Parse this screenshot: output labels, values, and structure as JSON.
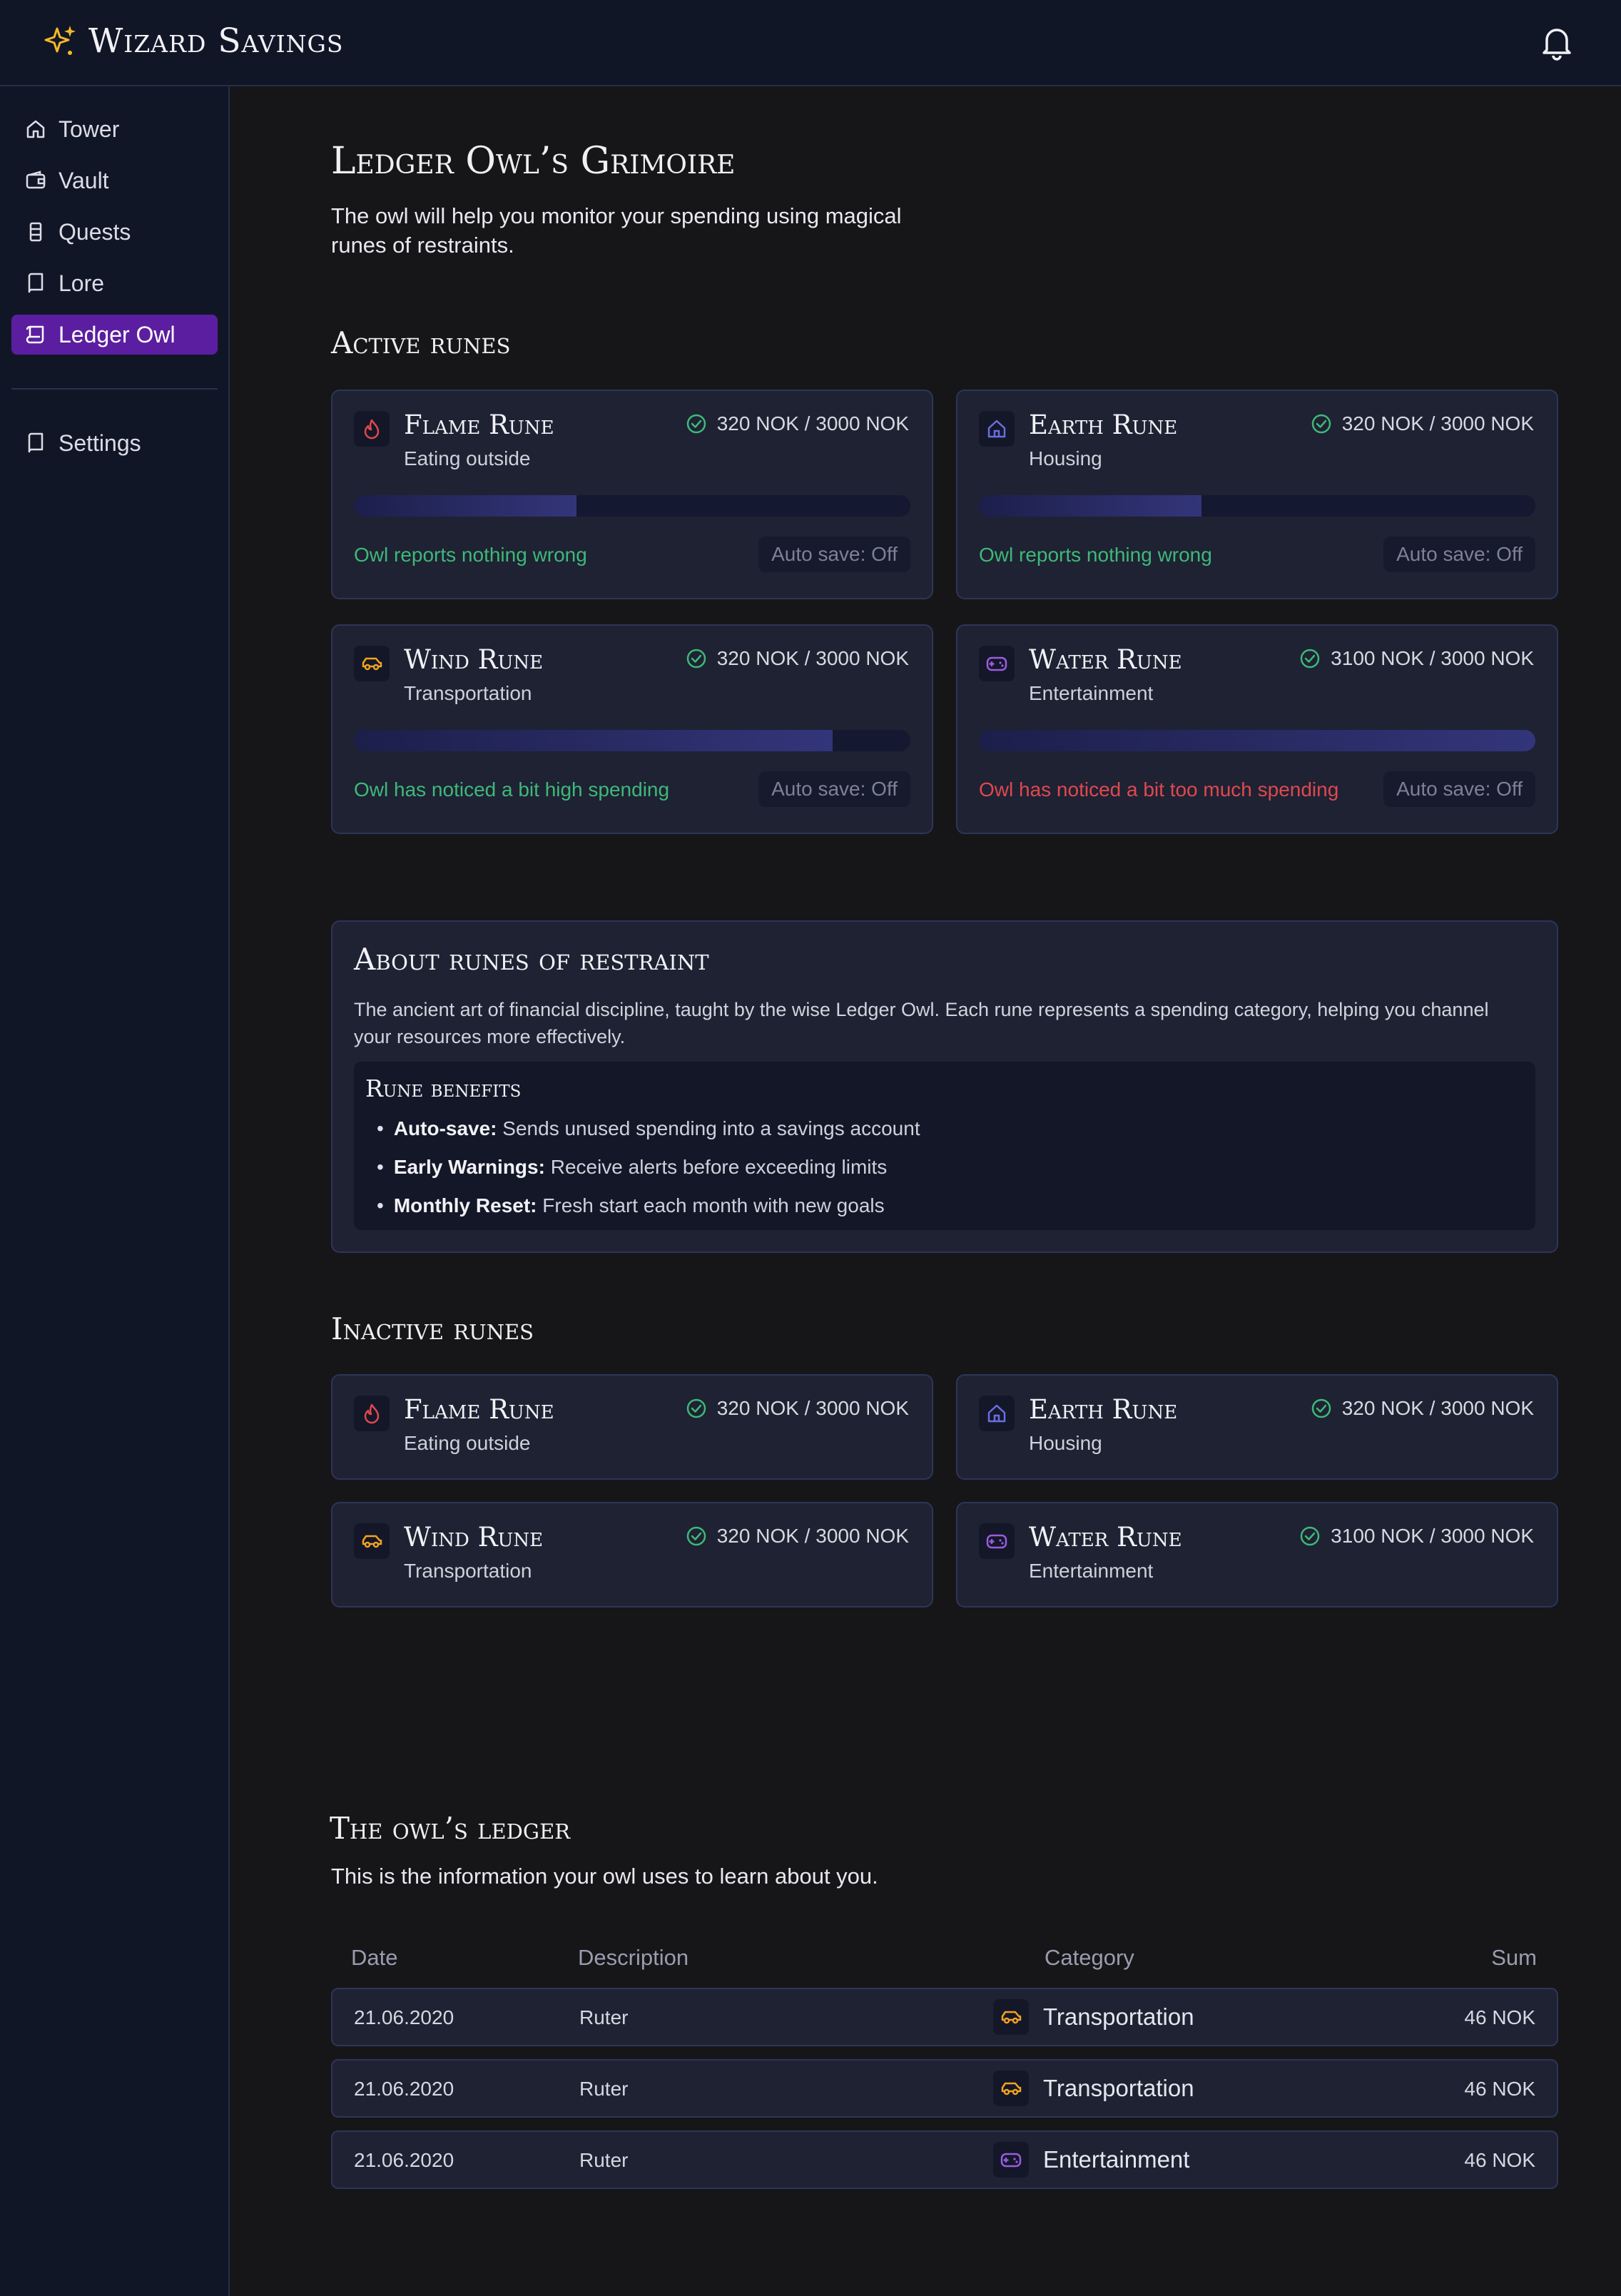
{
  "app": {
    "title": "Wizard Savings",
    "brand_color": "#f4b82a",
    "accent": "#5c1ea0"
  },
  "sidebar": {
    "items": [
      {
        "label": "Tower",
        "icon": "home-icon"
      },
      {
        "label": "Vault",
        "icon": "wallet-icon"
      },
      {
        "label": "Quests",
        "icon": "quest-icon"
      },
      {
        "label": "Lore",
        "icon": "book-icon"
      },
      {
        "label": "Ledger Owl",
        "icon": "scroll-icon",
        "active": true
      }
    ],
    "settings": {
      "label": "Settings",
      "icon": "book-icon"
    }
  },
  "page": {
    "title": "Ledger Owl’s Grimoire",
    "description": "The owl will help you monitor your spending using magical runes of restraints."
  },
  "active_runes": {
    "title": "Active runes",
    "cards": [
      {
        "name": "Flame Rune",
        "category": "Eating outside",
        "amount": "320 NOK / 3000 NOK",
        "progress": 0.4,
        "status": "Owl reports nothing wrong",
        "status_type": "ok",
        "autosave": "Auto save: Off",
        "icon": "flame-icon",
        "icon_color": "#e0484e"
      },
      {
        "name": "Earth Rune",
        "category": "Housing",
        "amount": "320 NOK / 3000 NOK",
        "progress": 0.4,
        "status": "Owl reports nothing wrong",
        "status_type": "ok",
        "autosave": "Auto save: Off",
        "icon": "house-icon",
        "icon_color": "#6a6ee0"
      },
      {
        "name": "Wind Rune",
        "category": "Transportation",
        "amount": "320 NOK / 3000 NOK",
        "progress": 0.86,
        "status": "Owl has noticed a bit high spending",
        "status_type": "ok",
        "autosave": "Auto save: Off",
        "icon": "car-icon",
        "icon_color": "#f4a31f"
      },
      {
        "name": "Water Rune",
        "category": "Entertainment",
        "amount": "3100 NOK / 3000 NOK",
        "progress": 1.0,
        "status": "Owl has noticed a bit too much spending",
        "status_type": "bad",
        "autosave": "Auto save: Off",
        "icon": "gamepad-icon",
        "icon_color": "#9a5ce0"
      }
    ]
  },
  "about": {
    "title": "About runes of restraint",
    "text": "The ancient art of financial discipline, taught by the wise Ledger Owl.  Each rune represents a spending category, helping you channel your  resources more effectively.",
    "benefits_title": "Rune benefits",
    "benefits": [
      {
        "term": "Auto-save:",
        "text": " Sends unused spending into a savings account"
      },
      {
        "term": "Early Warnings:",
        "text": " Receive alerts before exceeding limits"
      },
      {
        "term": "Monthly Reset:",
        "text": " Fresh start each month with new goals"
      }
    ]
  },
  "inactive_runes": {
    "title": "Inactive runes",
    "cards": [
      {
        "name": "Flame Rune",
        "category": "Eating outside",
        "amount": "320 NOK / 3000 NOK",
        "icon": "flame-icon"
      },
      {
        "name": "Earth Rune",
        "category": "Housing",
        "amount": "320 NOK / 3000 NOK",
        "icon": "house-icon"
      },
      {
        "name": "Wind Rune",
        "category": "Transportation",
        "amount": "320 NOK / 3000 NOK",
        "icon": "car-icon"
      },
      {
        "name": "Water Rune",
        "category": "Entertainment",
        "amount": "3100 NOK / 3000 NOK",
        "icon": "gamepad-icon"
      }
    ]
  },
  "ledger": {
    "title": "The owl’s ledger",
    "description": "This is the information your owl uses to learn about you.",
    "columns": [
      "Date",
      "Description",
      "Category",
      "Sum"
    ],
    "rows": [
      {
        "date": "21.06.2020",
        "description": "Ruter",
        "category": "Transportation",
        "icon": "car-icon",
        "sum": "46 NOK"
      },
      {
        "date": "21.06.2020",
        "description": "Ruter",
        "category": "Transportation",
        "icon": "car-icon",
        "sum": "46 NOK"
      },
      {
        "date": "21.06.2020",
        "description": "Ruter",
        "category": "Entertainment",
        "icon": "gamepad-icon",
        "sum": "46 NOK"
      }
    ]
  }
}
